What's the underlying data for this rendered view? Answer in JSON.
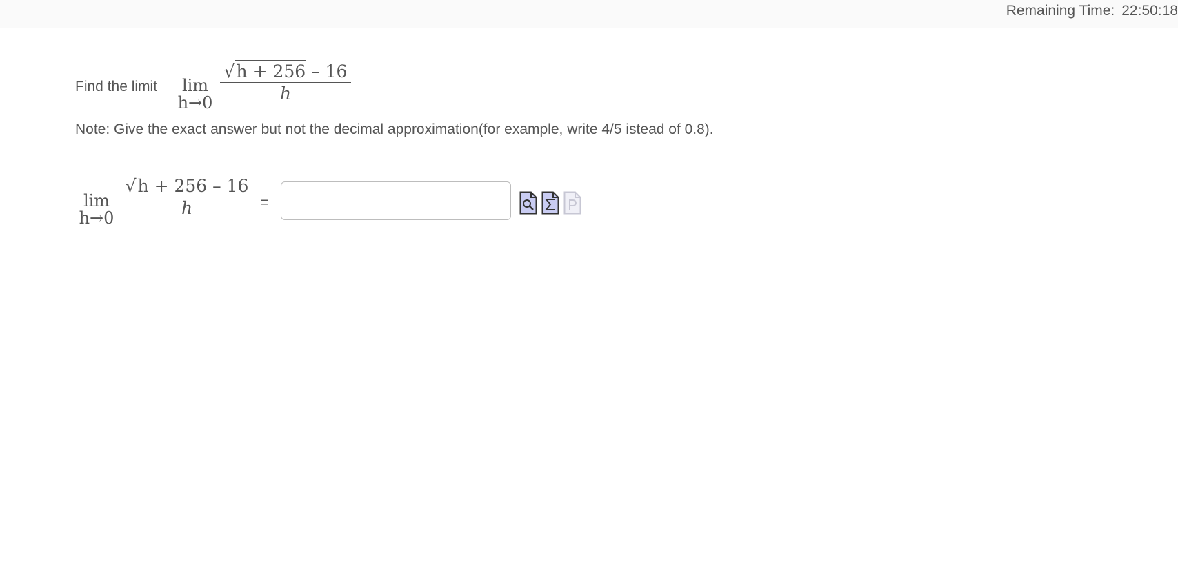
{
  "timer": {
    "label": "Remaining Time:",
    "value": "22:50:18"
  },
  "question": {
    "prompt": "Find the limit",
    "lim_word": "lim",
    "lim_sub": "h→0",
    "numerator_radicand": "h + 256",
    "numerator_rest": "– 16",
    "denominator": "h",
    "note": "Note: Give the exact answer but not the decimal approximation(for example, write 4/5 istead of 0.8)."
  },
  "answer": {
    "equals": "=",
    "value": "",
    "placeholder": ""
  },
  "tools": [
    {
      "icon": "preview-icon",
      "active": true
    },
    {
      "icon": "equation-editor-icon",
      "active": true
    },
    {
      "icon": "p-icon",
      "active": false
    }
  ],
  "colors": {
    "text": "#555555",
    "icon_fill": "#c9ccf2",
    "icon_stroke": "#333333",
    "border": "#bdbdbd"
  }
}
